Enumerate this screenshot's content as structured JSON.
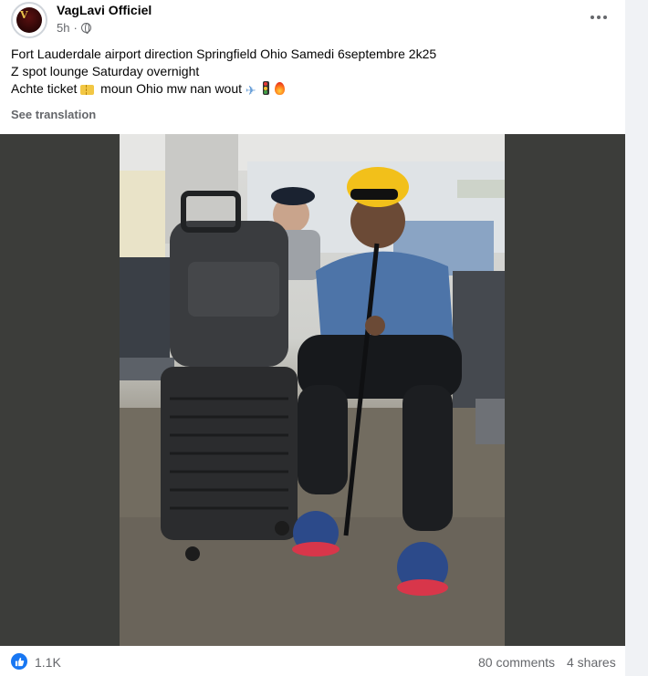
{
  "post": {
    "author": "VagLavi Officiel",
    "time": "5h",
    "privacy_icon": "globe-icon",
    "avatar_text": "VAGLAVI",
    "text_lines": [
      "Fort Lauderdale airport direction Springfield Ohio Samedi 6septembre 2k25",
      "Z spot lounge Saturday overnight"
    ],
    "line3_prefix": "Achte ticket",
    "line3_middle": "moun Ohio mw nan wout",
    "emojis": [
      "ticket-icon",
      "airplane-icon",
      "traffic-light-icon",
      "fire-icon"
    ],
    "see_translation": "See translation"
  },
  "photo": {
    "description_icon": "photo-man-at-airport-with-luggage"
  },
  "footer": {
    "reactions": "1.1K",
    "comments": "80 comments",
    "shares": "4 shares"
  },
  "colors": {
    "accent": "#1877f2",
    "secondary_text": "#65676b",
    "photo_letterbox": "#3c3d3a"
  }
}
